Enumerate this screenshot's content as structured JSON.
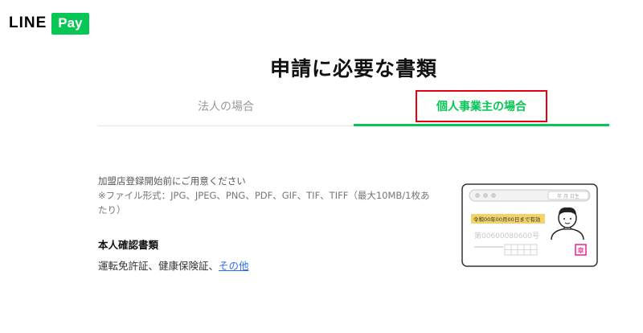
{
  "logo": {
    "line": "LINE",
    "pay": "Pay"
  },
  "page": {
    "title": "申請に必要な書類"
  },
  "tabs": [
    {
      "label": "法人の場合",
      "active": false
    },
    {
      "label": "個人事業主の場合",
      "active": true
    }
  ],
  "info": {
    "lead": "加盟店登録開始前にご用意ください",
    "formats": "※ファイル形式：JPG、JPEG、PNG、PDF、GIF、TIF、TIFF（最大10MB/1枚あたり）"
  },
  "identity": {
    "title": "本人確認書類",
    "docs_text": "運転免許証、健康保険証、",
    "other_link": "その他"
  },
  "illustration": {
    "validity": "令和00年00月00日まで有効",
    "number": "第00600080600号",
    "date_box": "年 月 日生",
    "stamp": "章"
  },
  "colors": {
    "accent": "#06c755",
    "highlight_border": "#e60012",
    "link": "#2a6df4"
  }
}
